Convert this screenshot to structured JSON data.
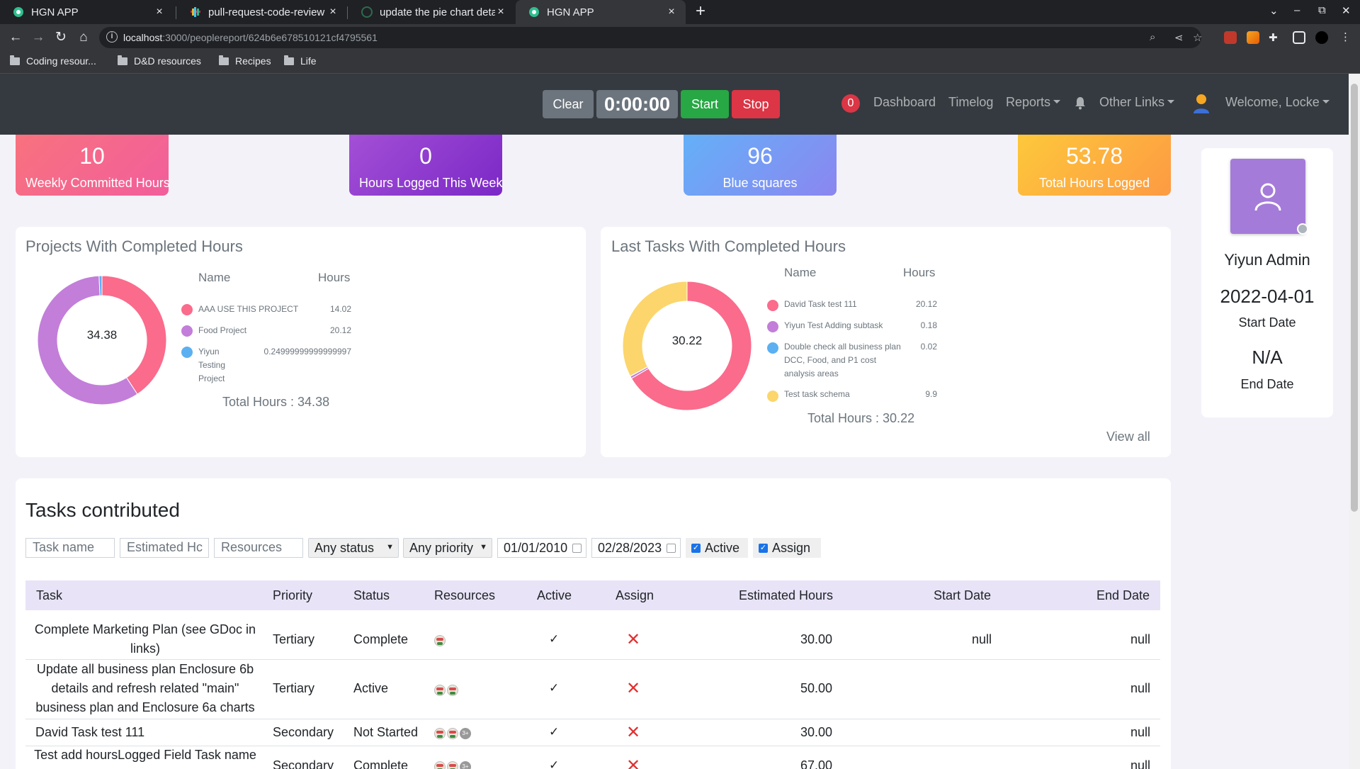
{
  "browser": {
    "tabs": [
      {
        "title": "HGN APP",
        "active": false
      },
      {
        "title": "pull-request-code-review",
        "active": false
      },
      {
        "title": "update the pie chart deta",
        "active": false
      },
      {
        "title": "HGN APP",
        "active": true
      }
    ],
    "url_host": "localhost",
    "url_path": ":3000/peoplereport/624b6e678510121cf4795561",
    "bookmarks": [
      "Coding resour...",
      "D&D resources",
      "Recipes",
      "Life"
    ]
  },
  "navbar": {
    "clear_label": "Clear",
    "timer": "0:00:00",
    "start_label": "Start",
    "stop_label": "Stop",
    "notification_count": "0",
    "dashboard": "Dashboard",
    "timelog": "Timelog",
    "reports": "Reports",
    "other_links": "Other Links",
    "welcome": "Welcome, Locke"
  },
  "stats": [
    {
      "value": "10",
      "label": "Weekly Committed Hours",
      "color": "#f26b8a"
    },
    {
      "value": "0",
      "label": "Hours Logged This Week",
      "color": "#8e3fcf"
    },
    {
      "value": "96",
      "label": "Blue squares",
      "color": "#6aa8f7"
    },
    {
      "value": "53.78",
      "label": "Total Hours Logged",
      "color": "#fcb63f"
    }
  ],
  "projects": {
    "title": "Projects With Completed Hours",
    "col_name": "Name",
    "col_hours": "Hours",
    "center": "34.38",
    "total_label": "Total Hours : 34.38",
    "items": [
      {
        "name": "AAA USE THIS PROJECT",
        "hours": "14.02",
        "color": "#fa6b8c"
      },
      {
        "name": "Food Project",
        "hours": "20.12",
        "color": "#c27ed9"
      },
      {
        "name": "Yiyun Testing Project",
        "hours": "0.24999999999999997",
        "color": "#5bb0f2"
      }
    ]
  },
  "tasks_chart": {
    "title": "Last Tasks With Completed Hours",
    "col_name": "Name",
    "col_hours": "Hours",
    "center": "30.22",
    "total_label": "Total Hours : 30.22",
    "view_all": "View all",
    "items": [
      {
        "name": "David Task test 111",
        "hours": "20.12",
        "color": "#fa6b8c"
      },
      {
        "name": "Yiyun Test Adding subtask",
        "hours": "0.18",
        "color": "#c27ed9"
      },
      {
        "name": "Double check all business plan DCC, Food, and P1 cost analysis areas",
        "hours": "0.02",
        "color": "#5bb0f2"
      },
      {
        "name": "Test task schema",
        "hours": "9.9",
        "color": "#fcd66c"
      }
    ]
  },
  "chart_data": [
    {
      "type": "pie",
      "categories": [
        "AAA USE THIS PROJECT",
        "Food Project",
        "Yiyun Testing Project"
      ],
      "values": [
        14.02,
        20.12,
        0.25
      ],
      "colors": [
        "#fa6b8c",
        "#c27ed9",
        "#5bb0f2"
      ]
    },
    {
      "type": "pie",
      "categories": [
        "David Task test 111",
        "Yiyun Test Adding subtask",
        "Double check all business plan DCC, Food, and P1 cost analysis areas",
        "Test task schema"
      ],
      "values": [
        20.12,
        0.18,
        0.02,
        9.9
      ],
      "colors": [
        "#fa6b8c",
        "#c27ed9",
        "#5bb0f2",
        "#fcd66c"
      ]
    }
  ],
  "profile": {
    "name": "Yiyun Admin",
    "start_date": "2022-04-01",
    "start_label": "Start Date",
    "end_date": "N/A",
    "end_label": "End Date"
  },
  "tasks": {
    "title": "Tasks contributed",
    "filters": {
      "task_name_placeholder": "Task name",
      "est_hours_placeholder": "Estimated Hc",
      "resources_placeholder": "Resources",
      "status": "Any status",
      "priority": "Any priority",
      "from_date": "01/01/2010",
      "to_date": "02/28/2023",
      "active_label": "Active",
      "assign_label": "Assign"
    },
    "columns": [
      "Task",
      "Priority",
      "Status",
      "Resources",
      "Active",
      "Assign",
      "Estimated Hours",
      "Start Date",
      "End Date"
    ],
    "rows": [
      {
        "task": "Complete Marketing Plan (see GDoc in links)",
        "priority": "Tertiary",
        "status": "Complete",
        "active": "✓",
        "estimated": "30.00",
        "start": "null",
        "end": "null"
      },
      {
        "task": "Update all business plan Enclosure 6b details and refresh related \"main\" business plan and Enclosure 6a charts",
        "priority": "Tertiary",
        "status": "Active",
        "active": "✓",
        "estimated": "50.00",
        "start": "",
        "end": "null"
      },
      {
        "task": "David Task test 111",
        "priority": "Secondary",
        "status": "Not Started",
        "active": "✓",
        "estimated": "30.00",
        "start": "",
        "end": "null"
      },
      {
        "task": "Test add hoursLogged Field Task name",
        "priority": "Secondary",
        "status": "Complete",
        "active": "✓",
        "estimated": "67.00",
        "start": "",
        "end": "null"
      }
    ],
    "more_resources": "3+"
  }
}
